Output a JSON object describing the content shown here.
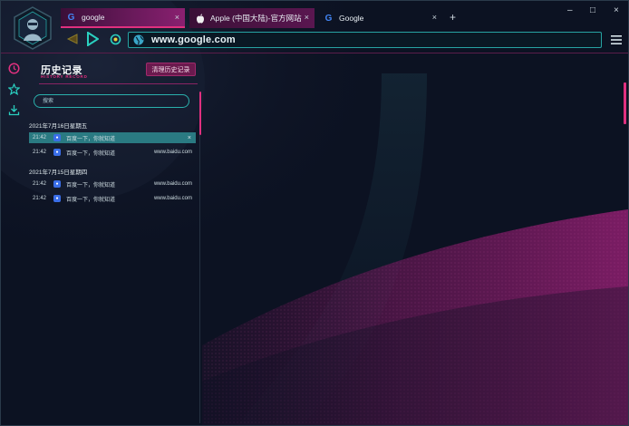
{
  "colors": {
    "accent_pink": "#e0307f",
    "accent_teal": "#27a3a3",
    "background": "#0c1222"
  },
  "tabs": [
    {
      "label": "google",
      "icon": "google-g-icon",
      "active": true
    },
    {
      "label": "Apple (中国大陆)-官方网站",
      "icon": "apple-icon",
      "active": false
    },
    {
      "label": "Google",
      "icon": "google-g-icon",
      "active": false
    }
  ],
  "tab_close_glyph": "×",
  "new_tab_glyph": "+",
  "window_controls": {
    "minimize": "–",
    "maximize": "□",
    "close": "×"
  },
  "address_bar": {
    "url": "www.google.com",
    "icon": "globe-icon"
  },
  "sidebar_icons": [
    "clock-icon",
    "star-icon",
    "download-icon"
  ],
  "history": {
    "title": "历史记录",
    "subtitle": "HISTORY RECORD",
    "clear_button": "清理历史记录",
    "search_placeholder": "搜索",
    "groups": [
      {
        "date": "2021年7月16日星期五",
        "items": [
          {
            "time": "21:42",
            "title": "百度一下，你就知道",
            "domain": "",
            "selected": true,
            "close": "×"
          },
          {
            "time": "21:42",
            "title": "百度一下，你就知道",
            "domain": "www.baidu.com",
            "selected": false
          }
        ]
      },
      {
        "date": "2021年7月15日星期四",
        "items": [
          {
            "time": "21:42",
            "title": "百度一下，你就知道",
            "domain": "www.baidu.com",
            "selected": false
          },
          {
            "time": "21:42",
            "title": "百度一下，你就知道",
            "domain": "www.baidu.com",
            "selected": false
          }
        ]
      }
    ]
  }
}
